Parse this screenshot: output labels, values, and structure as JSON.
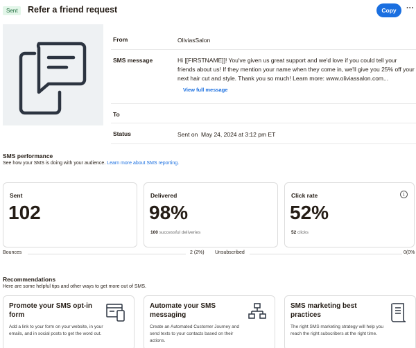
{
  "header": {
    "status_badge": "Sent",
    "title": "Refer a friend request",
    "copy_label": "Copy",
    "more_label": "···"
  },
  "details": {
    "from_label": "From",
    "from_value": "OliviasSalon",
    "sms_label": "SMS message",
    "sms_value": "Hi [[FIRSTNAME]]! You've given us great support and we'd love if you could tell your friends about us! If they mention your name when they come in, we'll give you 25% off your next hair cut and style. Thank you so much! Learn more: www.oliviassalon.com...",
    "view_full_label": "View full message",
    "to_label": "To",
    "to_value": "",
    "status_label": "Status",
    "status_value": "Sent on  May 24, 2024 at 3:12 pm ET"
  },
  "performance": {
    "title": "SMS performance",
    "desc": "See how your SMS is doing with your audience.",
    "desc_link": "Learn more about SMS reporting.",
    "cards": [
      {
        "label": "Sent",
        "value": "102",
        "sub_bold": "",
        "sub": ""
      },
      {
        "label": "Delivered",
        "value": "98%",
        "sub_bold": "100",
        "sub": "successful deliveries"
      },
      {
        "label": "Click rate",
        "value": "52%",
        "sub_bold": "52",
        "sub": "clicks"
      }
    ],
    "bounces_label": "Bounces",
    "bounces_value": "2 (2%)",
    "unsubscribed_label": "Unsubscribed",
    "unsubscribed_value": "0(0%"
  },
  "recommendations": {
    "title": "Recommendations",
    "desc": "Here are some helpful tips and other ways to get more out of SMS.",
    "cards": [
      {
        "title": "Promote your SMS opt-in form",
        "text": "Add a link to your form on your website, in your emails, and in social posts to get the word out.",
        "icon": "form-devices-icon"
      },
      {
        "title": "Automate your SMS messaging",
        "text": "Create an Automated Customer Journey and send texts to your contacts based on their actions.",
        "icon": "flowchart-icon"
      },
      {
        "title": "SMS marketing best practices",
        "text": "The right SMS marketing strategy will help you reach the right subscribers at the right time.",
        "icon": "document-icon"
      }
    ]
  },
  "colors": {
    "accent": "#1a6fe0",
    "badge_bg": "#e3f6e9",
    "preview_bg": "#eef1f3"
  }
}
